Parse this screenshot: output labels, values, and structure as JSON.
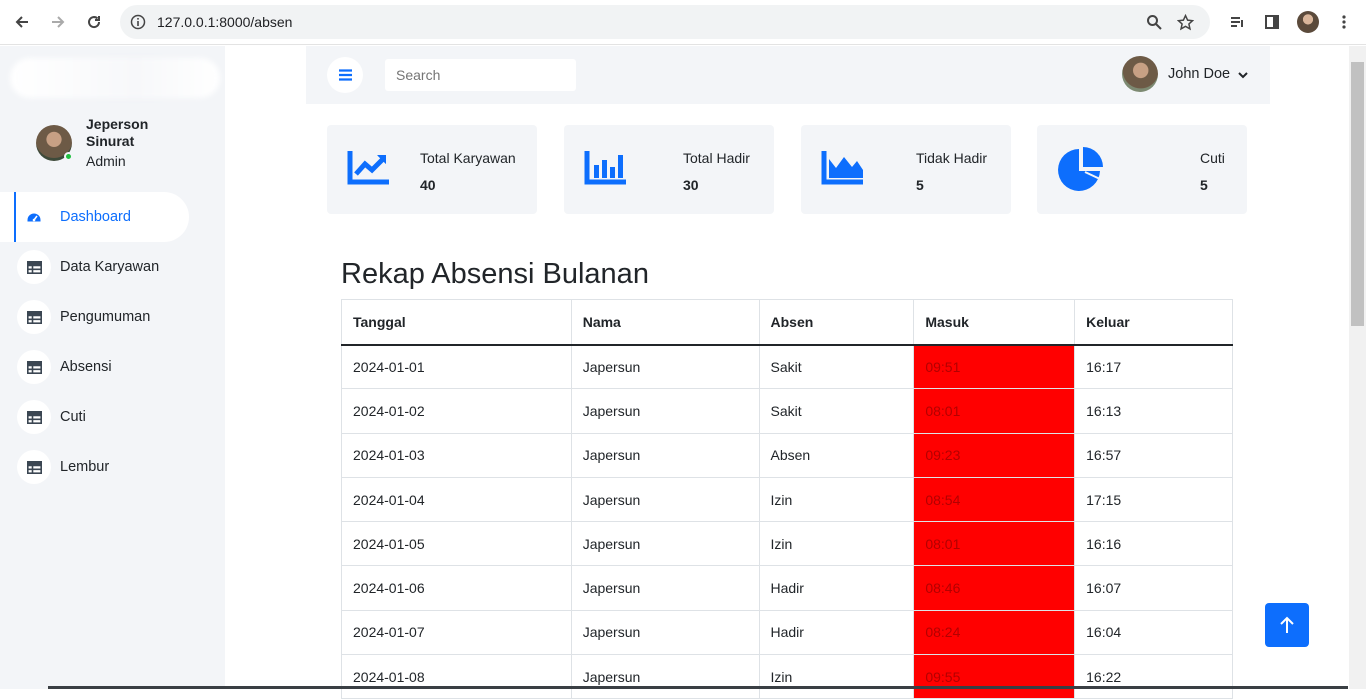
{
  "browser": {
    "url": "127.0.0.1:8000/absen"
  },
  "sidebar": {
    "profile": {
      "name": "Jeperson Sinurat",
      "role": "Admin"
    },
    "items": [
      {
        "label": "Dashboard",
        "active": true,
        "icon": "speedometer-icon"
      },
      {
        "label": "Data Karyawan",
        "icon": "table-icon"
      },
      {
        "label": "Pengumuman",
        "icon": "table-icon"
      },
      {
        "label": "Absensi",
        "icon": "table-icon"
      },
      {
        "label": "Cuti",
        "icon": "table-icon"
      },
      {
        "label": "Lembur",
        "icon": "table-icon"
      }
    ]
  },
  "topbar": {
    "search_placeholder": "Search",
    "user_name": "John Doe"
  },
  "stats": [
    {
      "label": "Total Karyawan",
      "value": "40",
      "icon": "line-chart-icon"
    },
    {
      "label": "Total Hadir",
      "value": "30",
      "icon": "bar-chart-icon"
    },
    {
      "label": "Tidak Hadir",
      "value": "5",
      "icon": "area-chart-icon"
    },
    {
      "label": "Cuti",
      "value": "5",
      "icon": "pie-chart-icon"
    }
  ],
  "table": {
    "title": "Rekap Absensi Bulanan",
    "headers": [
      "Tanggal",
      "Nama",
      "Absen",
      "Masuk",
      "Keluar"
    ],
    "rows": [
      [
        "2024-01-01",
        "Japersun",
        "Sakit",
        "09:51",
        "16:17"
      ],
      [
        "2024-01-02",
        "Japersun",
        "Sakit",
        "08:01",
        "16:13"
      ],
      [
        "2024-01-03",
        "Japersun",
        "Absen",
        "09:23",
        "16:57"
      ],
      [
        "2024-01-04",
        "Japersun",
        "Izin",
        "08:54",
        "17:15"
      ],
      [
        "2024-01-05",
        "Japersun",
        "Izin",
        "08:01",
        "16:16"
      ],
      [
        "2024-01-06",
        "Japersun",
        "Hadir",
        "08:46",
        "16:07"
      ],
      [
        "2024-01-07",
        "Japersun",
        "Hadir",
        "08:24",
        "16:04"
      ],
      [
        "2024-01-08",
        "Japersun",
        "Izin",
        "09:55",
        "16:22"
      ]
    ]
  },
  "colors": {
    "accent": "#0d6efd",
    "late": "#ff0000",
    "panel": "#f3f5f8"
  }
}
